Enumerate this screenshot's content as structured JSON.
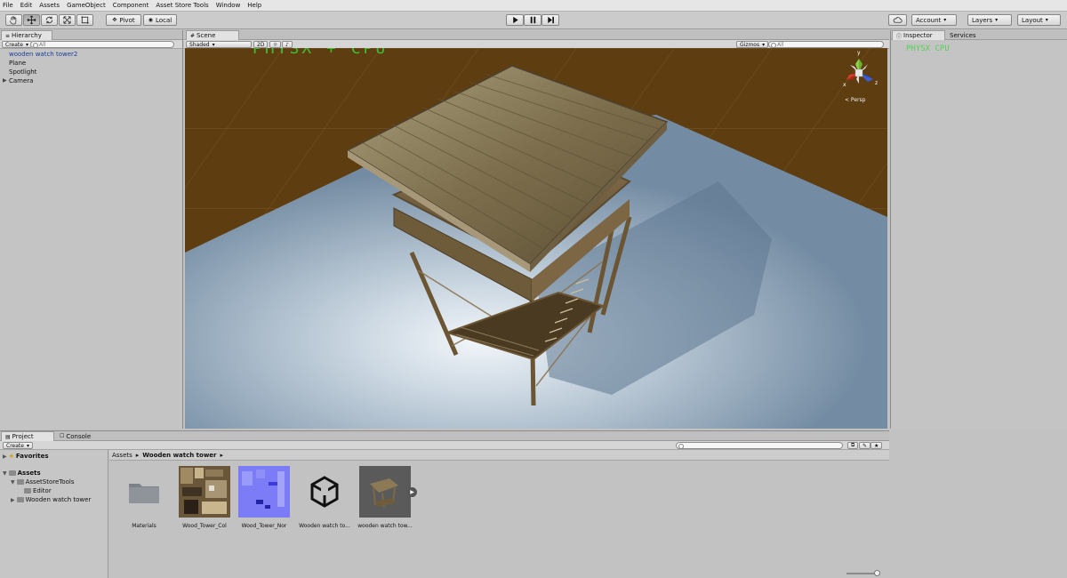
{
  "menu": [
    "File",
    "Edit",
    "Assets",
    "GameObject",
    "Component",
    "Asset Store Tools",
    "Window",
    "Help"
  ],
  "toolbar": {
    "pivot_label": "Pivot",
    "local_label": "Local",
    "account_label": "Account",
    "layers_label": "Layers",
    "layout_label": "Layout"
  },
  "hierarchy": {
    "tab_label": "Hierarchy",
    "create_label": "Create",
    "search_placeholder": "All",
    "items": [
      {
        "label": "wooden watch tower2",
        "selected": true
      },
      {
        "label": "Plane",
        "selected": false
      },
      {
        "label": "Spotlight",
        "selected": false
      },
      {
        "label": "Camera",
        "selected": false
      }
    ]
  },
  "scene": {
    "tab_label": "Scene",
    "shading_label": "Shaded",
    "mode_label": "2D",
    "gizmos_label": "Gizmos",
    "search_placeholder": "All",
    "overlay_text": "PHYSX + CPU",
    "projection_label": "< Persp",
    "axes": {
      "x": "x",
      "y": "y",
      "z": "z"
    }
  },
  "inspector": {
    "tab_label": "Inspector",
    "services_label": "Services",
    "overlay_text": "PHYSX CPU"
  },
  "project": {
    "tab_label": "Project",
    "console_label": "Console",
    "create_label": "Create",
    "breadcrumb": {
      "root": "Assets",
      "current": "Wooden watch tower"
    },
    "favorites_label": "Favorites",
    "tree": [
      {
        "label": "Assets",
        "bold": true
      },
      {
        "label": "AssetStoreTools",
        "bold": false
      },
      {
        "label": "Editor",
        "bold": false
      },
      {
        "label": "Wooden watch tower",
        "bold": false
      }
    ],
    "assets": [
      {
        "label": "Materials",
        "icon": "folder-icon"
      },
      {
        "label": "Wood_Tower_Col",
        "icon": "diffuse-texture"
      },
      {
        "label": "Wood_Tower_Nor",
        "icon": "normal-map-texture"
      },
      {
        "label": "Wooden watch to...",
        "icon": "unity-logo-icon"
      },
      {
        "label": "wooden watch tow...",
        "icon": "prefab-preview"
      }
    ]
  },
  "colors": {
    "ground_brown": "#5e3d11",
    "plane_blue": "#8fa8c0",
    "selection_text": "#1a3d9e",
    "physx_green": "#3bd43b"
  }
}
